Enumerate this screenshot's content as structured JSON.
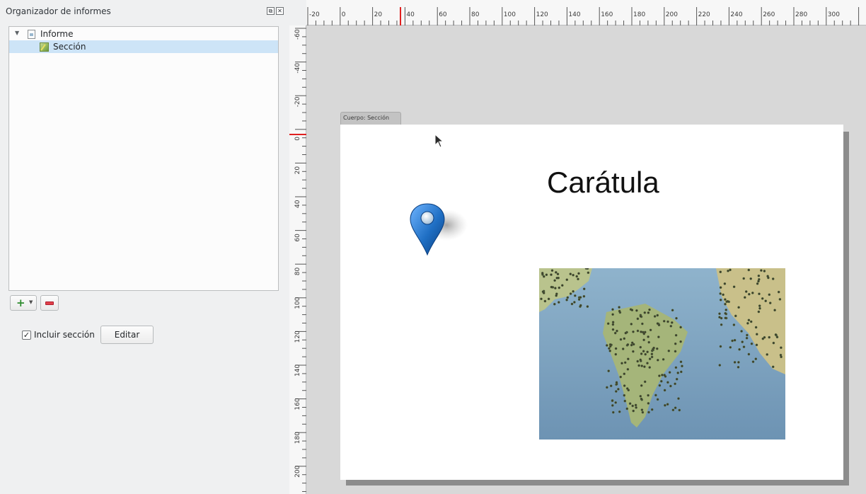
{
  "panel": {
    "title": "Organizador de informes",
    "float_glyph": "⧉",
    "close_glyph": "✕"
  },
  "tree": {
    "items": [
      {
        "label": "Informe",
        "icon": "document-icon",
        "expanded": true
      },
      {
        "label": "Sección",
        "icon": "section-icon",
        "selected": true
      }
    ]
  },
  "toolbar": {
    "add_icon": "add-section-icon",
    "remove_icon": "remove-section-icon"
  },
  "options": {
    "include_checked": true,
    "check_glyph": "✓",
    "include_label": "Incluir sección",
    "edit_label": "Editar"
  },
  "rulers": {
    "horizontal": [
      "-20",
      "0",
      "20",
      "40",
      "60",
      "80",
      "100",
      "120",
      "140",
      "160",
      "180",
      "200",
      "220",
      "240",
      "260",
      "280",
      "300"
    ],
    "vertical": [
      "-60",
      "-40",
      "-20",
      "0",
      "20",
      "40",
      "60",
      "80",
      "100",
      "120",
      "140",
      "160",
      "180",
      "200"
    ]
  },
  "canvas": {
    "section_tab": "Cuerpo: Sección",
    "page_title": "Carátula"
  },
  "colors": {
    "selection": "#cde4f7",
    "ruler_marker": "#e02020",
    "canvas_bg": "#d8d8d8",
    "pin_blue": "#1f6fc4"
  }
}
